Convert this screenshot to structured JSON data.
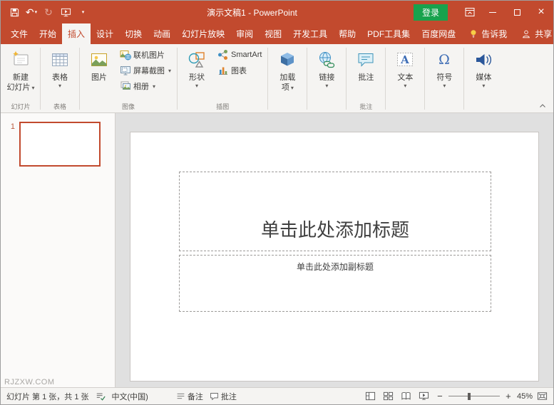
{
  "colors": {
    "accent": "#C24A2E",
    "titlebar_bg": "#C24A2E",
    "signin_bg": "#18A24D",
    "ribbon_bg": "#F5F4F2",
    "canvas_bg": "#E0E0E0"
  },
  "titlebar": {
    "title": "演示文稿1 - PowerPoint",
    "signin_label": "登录"
  },
  "tabs": {
    "items": [
      "文件",
      "开始",
      "插入",
      "设计",
      "切换",
      "动画",
      "幻灯片放映",
      "审阅",
      "视图",
      "开发工具",
      "帮助",
      "PDF工具集",
      "百度网盘"
    ],
    "active": "插入",
    "tellme": "告诉我",
    "share": "共享"
  },
  "ribbon": {
    "slides": {
      "label": "幻灯片",
      "new_slide": "新建\n幻灯片"
    },
    "tables": {
      "label": "表格",
      "table": "表格"
    },
    "images": {
      "label": "图像",
      "picture": "图片",
      "online_pictures": "联机图片",
      "screenshot": "屏幕截图",
      "photo_album": "相册"
    },
    "illustrations": {
      "label": "插图",
      "shapes": "形状",
      "smartart": "SmartArt",
      "chart": "图表"
    },
    "addins": {
      "label": "",
      "addins": "加载\n项"
    },
    "links": {
      "label": "",
      "link": "链接"
    },
    "comments": {
      "label": "批注",
      "comment": "批注"
    },
    "text": {
      "label": "",
      "text": "文本"
    },
    "symbols": {
      "label": "",
      "symbol": "符号"
    },
    "media": {
      "label": "",
      "media": "媒体"
    }
  },
  "slide_panel": {
    "slide_number": "1"
  },
  "slide": {
    "title_placeholder": "单击此处添加标题",
    "subtitle_placeholder": "单击此处添加副标题"
  },
  "watermark": "RJZXW.COM",
  "statusbar": {
    "slide_info": "幻灯片 第 1 张，共 1 张",
    "language": "中文(中国)",
    "notes": "备注",
    "comments": "批注",
    "zoom_level": "45%"
  }
}
